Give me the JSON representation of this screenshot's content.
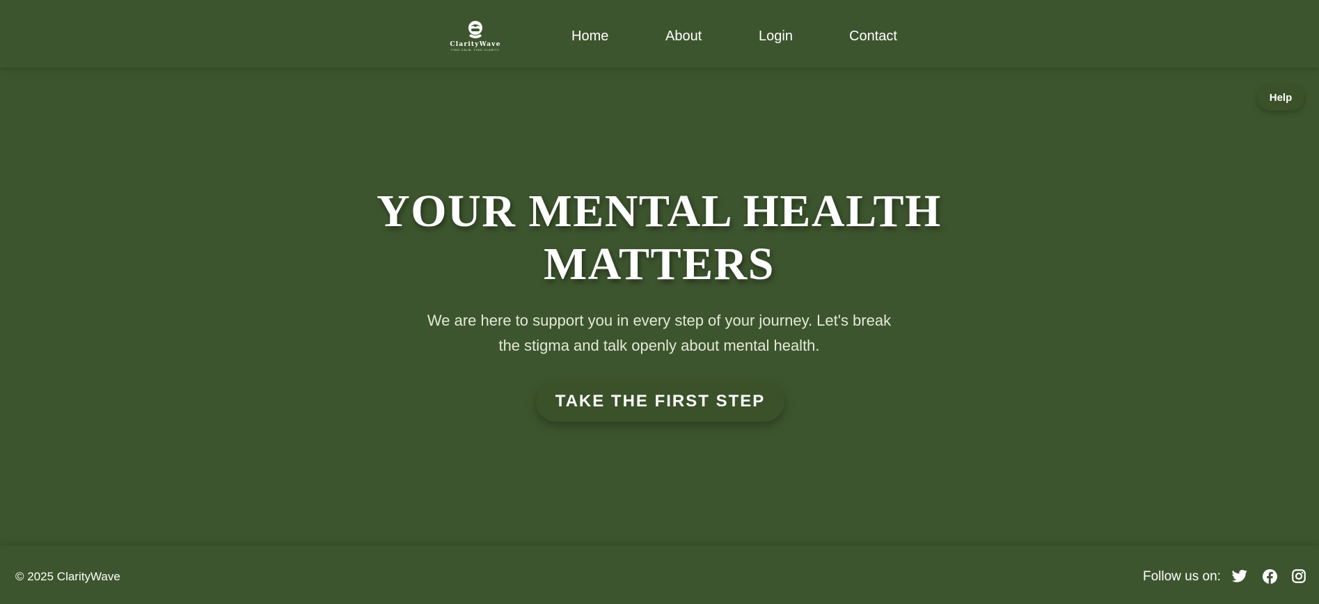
{
  "header": {
    "logo": {
      "name": "ClarityWave",
      "tagline": "FIND CALM, FIND CLARITY"
    },
    "nav": [
      {
        "label": "Home"
      },
      {
        "label": "About"
      },
      {
        "label": "Login"
      },
      {
        "label": "Contact"
      }
    ]
  },
  "help": {
    "label": "Help"
  },
  "hero": {
    "title": "YOUR MENTAL HEALTH MATTERS",
    "subtitle": "We are here to support you in every step of your journey. Let's break the stigma and talk openly about mental health.",
    "cta_label": "TAKE THE FIRST STEP"
  },
  "footer": {
    "copyright": "© 2025 ClarityWave",
    "follow_label": "Follow us on:",
    "social": [
      {
        "icon": "twitter-icon"
      },
      {
        "icon": "facebook-icon"
      },
      {
        "icon": "instagram-icon"
      }
    ]
  },
  "colors": {
    "background": "#3d552e",
    "button": "#3a5129",
    "text": "#ffffff",
    "subtitle": "#e3ead6"
  }
}
